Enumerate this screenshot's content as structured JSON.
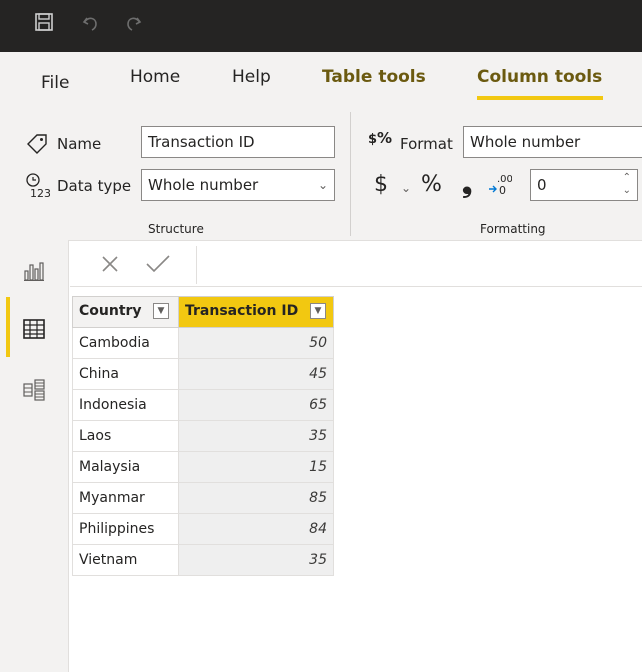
{
  "ribbon_tabs": {
    "file": "File",
    "home": "Home",
    "help": "Help",
    "table_tools": "Table tools",
    "column_tools": "Column tools"
  },
  "structure": {
    "name_label": "Name",
    "name_value": "Transaction ID",
    "datatype_label": "Data type",
    "datatype_value": "Whole number",
    "caption": "Structure"
  },
  "formatting": {
    "format_label": "Format",
    "format_value": "Whole number",
    "currency_symbol": "$",
    "percent_symbol": "%",
    "comma_symbol": "❟",
    "decimal_places": "0",
    "caption": "Formatting"
  },
  "table": {
    "columns": [
      "Country",
      "Transaction ID"
    ],
    "rows": [
      {
        "country": "Cambodia",
        "id": "50"
      },
      {
        "country": "China",
        "id": "45"
      },
      {
        "country": "Indonesia",
        "id": "65"
      },
      {
        "country": "Laos",
        "id": "35"
      },
      {
        "country": "Malaysia",
        "id": "15"
      },
      {
        "country": "Myanmar",
        "id": "85"
      },
      {
        "country": "Philippines",
        "id": "84"
      },
      {
        "country": "Vietnam",
        "id": "35"
      }
    ]
  },
  "colors": {
    "accent": "#f2c811",
    "titlebar": "#252423",
    "ribbon": "#f3f2f1"
  },
  "icons": {
    "save": "save-icon",
    "undo": "undo-icon",
    "redo": "redo-icon",
    "tag": "tag-icon",
    "datatype": "datatype-icon",
    "report_view": "bar-chart-icon",
    "data_view": "table-grid-icon",
    "model_view": "model-icon"
  }
}
